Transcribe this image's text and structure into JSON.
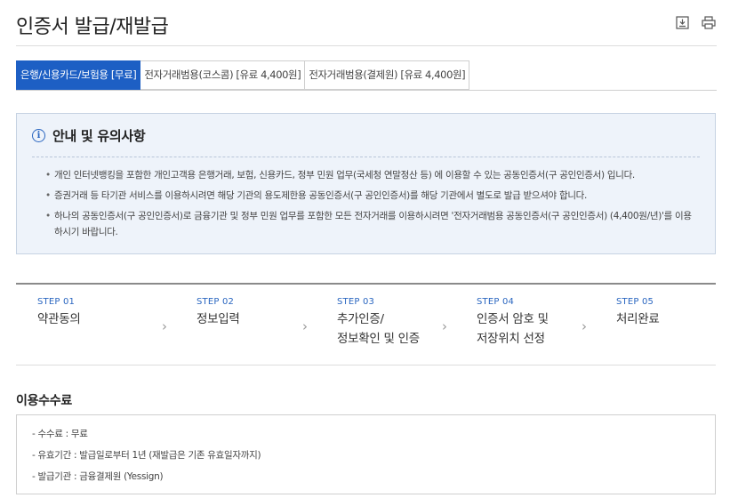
{
  "header": {
    "title": "인증서 발급/재발급",
    "tools": [
      "download-icon",
      "print-icon"
    ]
  },
  "tabs": [
    {
      "label": "은행/신용카드/보험용 [무료]",
      "active": true
    },
    {
      "label": "전자거래범용(코스콤) [유료 4,400원]",
      "active": false
    },
    {
      "label": "전자거래범용(결제원) [유료 4,400원]",
      "active": false
    }
  ],
  "notice": {
    "title": "안내 및 유의사항",
    "items": [
      "개인 인터넷뱅킹을 포함한 개인고객용 은행거래, 보험, 신용카드, 정부 민원 업무(국세청 연말정산 등) 에 이용할 수 있는 공동인증서(구 공인인증서) 입니다.",
      "증권거래 등 타기관 서비스를 이용하시려면 해당 기관의 용도제한용 공동인증서(구 공인인증서)를 해당 기관에서 별도로 발급 받으셔야 합니다.",
      "하나의 공동인증서(구 공인인증서)로 금융기관 및 정부 민원 업무를 포함한 모든 전자거래를 이용하시려면 '전자거래범용 공동인증서(구 공인인증서) (4,400원/년)'를 이용하시기 바랍니다."
    ]
  },
  "steps": [
    {
      "num": "STEP 01",
      "line1": "약관동의",
      "line2": ""
    },
    {
      "num": "STEP 02",
      "line1": "정보입력",
      "line2": ""
    },
    {
      "num": "STEP 03",
      "line1": "추가인증/",
      "line2": "정보확인 및 인증"
    },
    {
      "num": "STEP 04",
      "line1": "인증서 암호 및",
      "line2": "저장위치 선정"
    },
    {
      "num": "STEP 05",
      "line1": "처리완료",
      "line2": ""
    }
  ],
  "fee": {
    "title": "이용수수료",
    "items": [
      "- 수수료 : 무료",
      "- 유효기간 : 발급일로부터 1년 (재발급은 기존 유효일자까지)",
      "- 발급기관 : 금융결제원 (Yessign)"
    ]
  },
  "colors": {
    "accent": "#1d5fc4",
    "notice_bg": "#eef3fa",
    "step_num": "#2a66c0"
  }
}
